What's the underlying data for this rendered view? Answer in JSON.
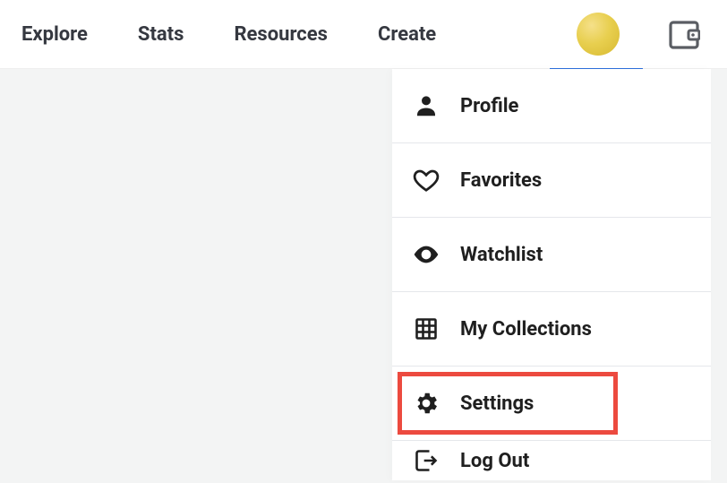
{
  "nav": {
    "explore": "Explore",
    "stats": "Stats",
    "resources": "Resources",
    "create": "Create"
  },
  "menu": {
    "profile": "Profile",
    "favorites": "Favorites",
    "watchlist": "Watchlist",
    "my_collections": "My Collections",
    "settings": "Settings",
    "log_out": "Log Out"
  }
}
